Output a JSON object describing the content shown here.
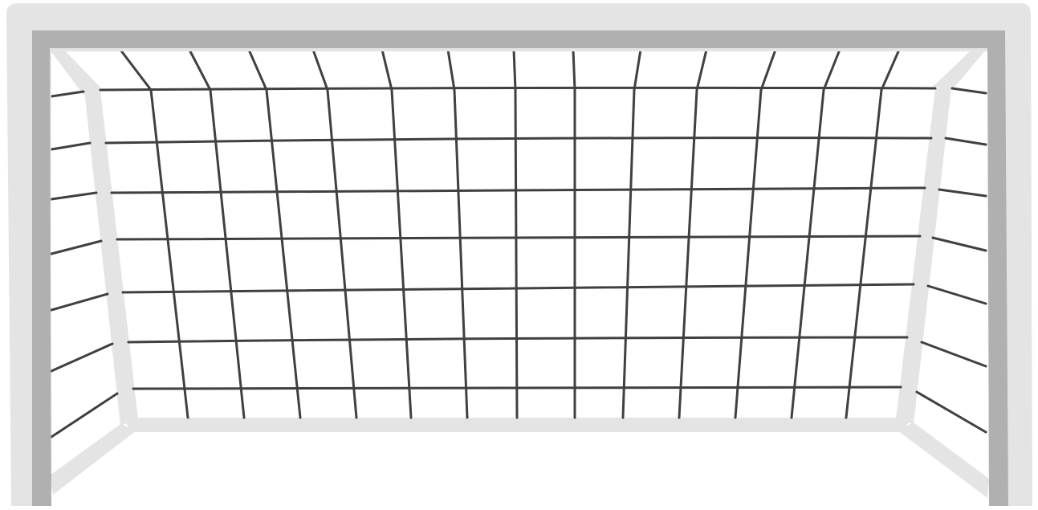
{
  "illustration": {
    "colors": {
      "background": "#ffffff",
      "frame_outer": "#e4e4e4",
      "frame_inner": "#b0b0b0",
      "net_line": "#404040"
    },
    "icon": "soccer-goal-icon"
  }
}
